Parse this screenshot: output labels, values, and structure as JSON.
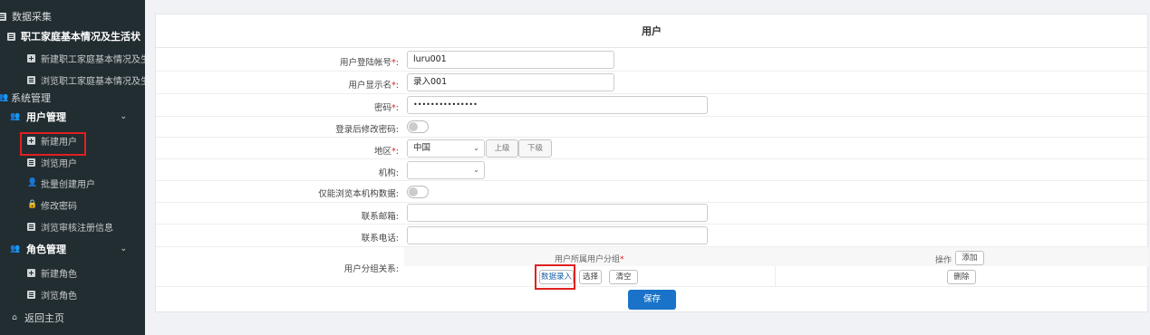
{
  "sidebar": {
    "data_collection": "数据采集",
    "employee_group": "职工家庭基本情况及生活状",
    "employee_new": "新建职工家庭基本情况及生",
    "employee_browse": "浏览职工家庭基本情况及生",
    "system_manage": "系统管理",
    "user_manage": "用户管理",
    "user_items": [
      "新建用户",
      "浏览用户",
      "批量创建用户",
      "修改密码",
      "浏览审核注册信息"
    ],
    "role_manage": "角色管理",
    "role_items": [
      "新建角色",
      "浏览角色"
    ],
    "back_home": "返回主页"
  },
  "form": {
    "title": "用户",
    "login_label": "用户登陆帐号",
    "login_value": "luru001",
    "display_label": "用户显示名",
    "display_value": "录入001",
    "password_label": "密码",
    "password_value": "•••••••••••••••",
    "change_pwd_label": "登录后修改密码:",
    "region_label": "地区",
    "region_value": "中国",
    "region_up": "上级",
    "region_down": "下级",
    "org_label": "机构:",
    "own_org_label": "仅能浏览本机构数据:",
    "email_label": "联系邮箱:",
    "phone_label": "联系电话:",
    "group_label": "用户分组关系:",
    "group_col_label": "用户所属用户分组",
    "op_col_label": "操作",
    "add_button": "添加",
    "data_entry_button": "数据录入",
    "select_button": "选择",
    "clear_button": "清空",
    "delete_button": "删除",
    "save_button": "保存"
  },
  "colors": {
    "sidebar_bg": "#222d32",
    "accent": "#1a73c9",
    "highlight": "#e02020"
  }
}
